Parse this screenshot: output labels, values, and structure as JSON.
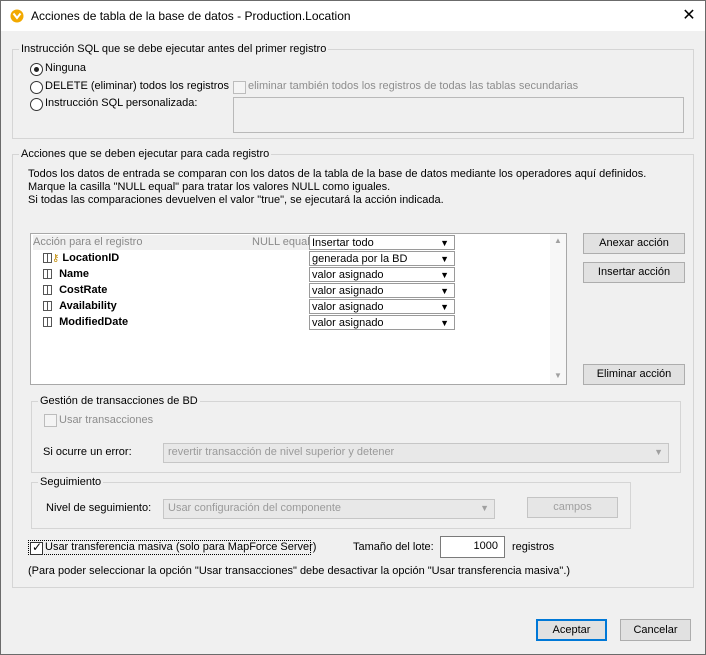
{
  "window": {
    "title": "Acciones de tabla de la base de datos - Production.Location",
    "close_glyph": "✕"
  },
  "pre_sql": {
    "legend": "Instrucción SQL que se debe ejecutar antes del primer registro",
    "opt_none": "Ninguna",
    "opt_delete": "DELETE (eliminar) todos los registros",
    "delete_children": "eliminar también todos los registros de todas las tablas secundarias",
    "opt_custom": "Instrucción SQL personalizada:",
    "custom_value": "",
    "selected": "Ninguna"
  },
  "actions": {
    "legend": "Acciones que se deben ejecutar para cada registro",
    "desc1": "Todos los datos de entrada se comparan con los datos de la tabla de la base de datos mediante los operadores aquí definidos.",
    "desc2": "Marque la casilla \"NULL equal\" para tratar los valores NULL como iguales.",
    "desc3": "Si todas las comparaciones devuelven el valor \"true\", se ejecutará la acción indicada.",
    "grid": {
      "header_action": "Acción para el registro",
      "header_null": "NULL equal",
      "header_value": "Insertar todo",
      "rows": [
        {
          "name": "LocationID",
          "value": "generada por la BD",
          "key": true
        },
        {
          "name": "Name",
          "value": "valor asignado",
          "key": false
        },
        {
          "name": "CostRate",
          "value": "valor asignado",
          "key": false
        },
        {
          "name": "Availability",
          "value": "valor asignado",
          "key": false
        },
        {
          "name": "ModifiedDate",
          "value": "valor asignado",
          "key": false
        }
      ]
    },
    "btn_append": "Anexar acción",
    "btn_insert": "Insertar acción",
    "btn_delete": "Eliminar acción"
  },
  "transactions": {
    "legend": "Gestión de transacciones de BD",
    "use_transactions": "Usar transacciones",
    "on_error_label": "Si ocurre un error:",
    "on_error_value": "revertir transacción de nivel superior y detener"
  },
  "tracing": {
    "legend": "Seguimiento",
    "level_label": "Nivel de seguimiento:",
    "level_value": "Usar configuración del componente",
    "fields_button": "campos"
  },
  "bulk": {
    "label": "Usar transferencia masiva (solo para MapForce Server)",
    "checked": true,
    "batch_label": "Tamaño del lote:",
    "batch_value": "1000",
    "batch_unit": "registros",
    "note": "(Para poder seleccionar la opción \"Usar transacciones\" debe desactivar la opción \"Usar transferencia masiva\".)"
  },
  "footer": {
    "ok": "Aceptar",
    "cancel": "Cancelar"
  }
}
